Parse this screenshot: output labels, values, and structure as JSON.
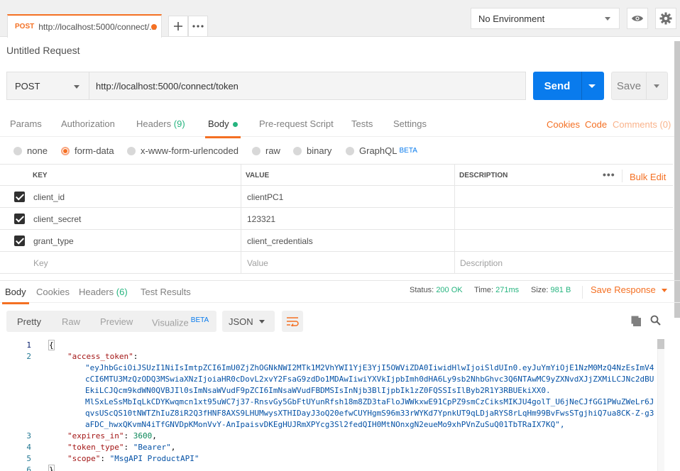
{
  "tab": {
    "method": "POST",
    "title": "http://localhost:5000/connect/..."
  },
  "environment": {
    "selected": "No Environment"
  },
  "request": {
    "name": "Untitled Request",
    "method": "POST",
    "url": "http://localhost:5000/connect/token",
    "send_label": "Send",
    "save_label": "Save"
  },
  "request_tabs": {
    "params": "Params",
    "authorization": "Authorization",
    "headers": "Headers",
    "headers_count": "(9)",
    "body": "Body",
    "prerequest": "Pre-request Script",
    "tests": "Tests",
    "settings": "Settings",
    "cookies": "Cookies",
    "code": "Code",
    "comments": "Comments (0)"
  },
  "body_modes": {
    "none": "none",
    "form_data": "form-data",
    "urlencoded": "x-www-form-urlencoded",
    "raw": "raw",
    "binary": "binary",
    "graphql": "GraphQL",
    "beta": "BETA"
  },
  "kv_table": {
    "col_key": "KEY",
    "col_value": "VALUE",
    "col_description": "DESCRIPTION",
    "bulk_edit": "Bulk Edit",
    "rows": [
      {
        "key": "client_id",
        "value": "clientPC1"
      },
      {
        "key": "client_secret",
        "value": "123321"
      },
      {
        "key": "grant_type",
        "value": "client_credentials"
      }
    ],
    "placeholder_key": "Key",
    "placeholder_value": "Value",
    "placeholder_description": "Description"
  },
  "response": {
    "tabs": {
      "body": "Body",
      "cookies": "Cookies",
      "headers": "Headers",
      "headers_count": "(6)",
      "test_results": "Test Results"
    },
    "status_label": "Status:",
    "status_value": "200 OK",
    "time_label": "Time:",
    "time_value": "271ms",
    "size_label": "Size:",
    "size_value": "981 B",
    "save_response": "Save Response",
    "formats": {
      "pretty": "Pretty",
      "raw": "Raw",
      "preview": "Preview",
      "visualize": "Visualize",
      "beta": "BETA"
    },
    "language": "JSON"
  },
  "code": {
    "line_numbers": [
      "1",
      "2",
      "",
      "",
      "",
      "",
      "",
      "",
      "3",
      "4",
      "5",
      "6"
    ],
    "open_brace": "{",
    "close_brace": "}",
    "access_token_key": "\"access_token\"",
    "access_token_lines": [
      "\"eyJhbGciOiJSUzI1NiIsImtpZCI6ImU0ZjZhOGNkNWI2MTk1M2VhYWI1YjE3YjI5OWViZDA0IiwidHlwIjoiSldUIn0.eyJuYmYiOjE1NzM0MzQ4NzEsImV4",
      "cCI6MTU3MzQzODQ3MSwiaXNzIjoiaHR0cDovL2xvY2FsaG9zdDo1MDAwIiwiYXVkIjpbImh0dHA6Ly9sb2NhbGhvc3Q6NTAwMC9yZXNvdXJjZXMiLCJNc2dBU",
      "EkiLCJQcm9kdWN0QVBJIl0sImNsaWVudF9pZCI6ImNsaWVudFBDMSIsInNjb3BlIjpbIk1zZ0FQSSIsIlByb2R1Y3RBUEkiXX0.",
      "MlSxLeSsMbIqLkCDYKwqmcn1xt95uWC7j37-RnsvGy5GbFtUYunRfsh18m8ZD3taFloJWWkxwE91CpPZ9smCzCiksMIKJU4golT_U6jNeCJfGG1PWuZWeLr6J",
      "qvsUScQS10tNWTZhIuZ8iR2Q3fHNF8AXS9LHUMwysXTHIDayJ3oQ20efwCUYHgmS96m33rWYKd7YpnkUT9qLDjaRYS8rLqHm99BvFwsSTgjhiQ7ua8CK-Z-g3",
      "aFDC_hwxQKvmN4iTfGNVDpKMonVvY-AnIpaisvDKEgHUJRmXPYcg3Sl2fedQIH0MtNOnxgN2eueMo9xhPVnZuSuQ01TbTRaIX7KQ\","
    ],
    "expires_in_key": "\"expires_in\"",
    "expires_in_value": "3600",
    "token_type_key": "\"token_type\"",
    "token_type_value": "\"Bearer\"",
    "scope_key": "\"scope\"",
    "scope_value": "\"MsgAPI ProductAPI\""
  }
}
